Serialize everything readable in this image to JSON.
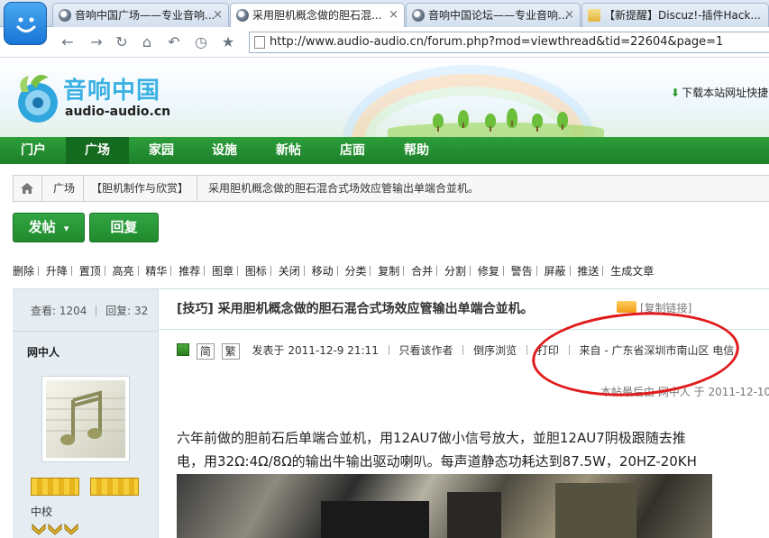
{
  "browser": {
    "tabs": [
      {
        "label": "音响中国广场——专业音响...",
        "active": false
      },
      {
        "label": "采用胆机概念做的胆石混...",
        "active": true
      },
      {
        "label": "音响中国论坛——专业音响...",
        "active": false
      },
      {
        "label": "【新提醒】Discuz!-插件Hack...",
        "active": false
      }
    ],
    "close_glyph": "×",
    "url": "http://www.audio-audio.cn/forum.php?mod=viewthread&tid=22604&page=1"
  },
  "site": {
    "logo_cn": "音响中国",
    "logo_en": "audio-audio.cn",
    "download_link": "下载本站网址快捷",
    "nav": [
      "门户",
      "广场",
      "家园",
      "设施",
      "新帖",
      "店面",
      "帮助"
    ],
    "nav_active_index": 1,
    "accent_color": "#1d7f2a"
  },
  "breadcrumb": [
    "广场",
    "【胆机制作与欣赏】",
    "采用胆机概念做的胆石混合式场效应管输出单端合並机。"
  ],
  "actions": {
    "post": "发帖",
    "post_arrow": "▾",
    "reply": "回复"
  },
  "moderation": [
    "删除",
    "升降",
    "置顶",
    "高亮",
    "精华",
    "推荐",
    "图章",
    "图标",
    "关闭",
    "移动",
    "分类",
    "复制",
    "合并",
    "分割",
    "修复",
    "警告",
    "屏蔽",
    "推送",
    "生成文章"
  ],
  "thread": {
    "views_label": "查看:",
    "views": "1204",
    "replies_label": "回复:",
    "replies": "32",
    "title_tag": "[技巧]",
    "title": "采用胆机概念做的胆石混合式场效应管输出单端合並机。",
    "copy_link": "[复制链接]"
  },
  "post": {
    "author": "网中人",
    "rank": "中校",
    "simplified": "简",
    "traditional": "繁",
    "posted": "发表于 2011-12-9 21:11",
    "only_author": "只看该作者",
    "reverse": "倒序浏览",
    "print": "打印",
    "from": "来自 - 广东省深圳市南山区 电信",
    "last_edit": "本帖最后由 网中人 于 2011-12-10",
    "body_line1": "六年前做的胆前石后单端合並机，用12AU7做小信号放大，並胆12AU7阴极跟随去推",
    "body_line2": "电，用32Ω:4Ω/8Ω的输出牛输出驱动喇叭。每声道静态功耗达到87.5W，20HZ-20KH"
  }
}
